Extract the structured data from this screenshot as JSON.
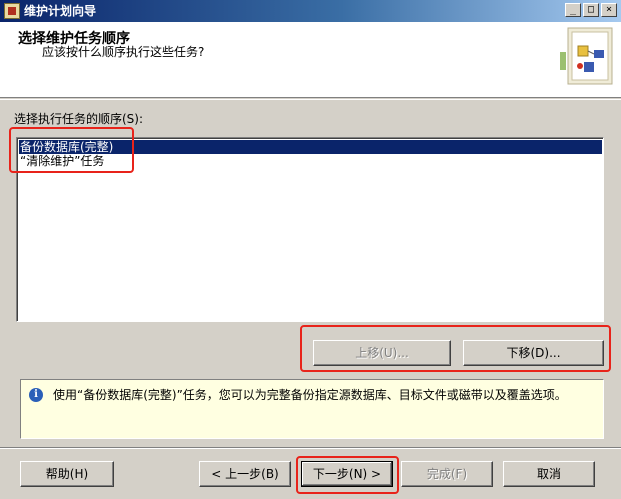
{
  "window": {
    "title": "维护计划向导",
    "minimize_glyph": "_",
    "maximize_glyph": "□",
    "close_glyph": "×"
  },
  "header": {
    "title": "选择维护任务顺序",
    "subtitle": "应该按什么顺序执行这些任务?"
  },
  "order_section": {
    "label": "选择执行任务的顺序(S):",
    "tasks": [
      {
        "label": "备份数据库(完整)",
        "selected": true
      },
      {
        "label": "“清除维护”任务",
        "selected": false
      }
    ]
  },
  "reorder_buttons": {
    "move_up": "上移(U)...",
    "move_down": "下移(D)..."
  },
  "info": {
    "icon": "info-icon",
    "text": "使用“备份数据库(完整)”任务，您可以为完整备份指定源数据库、目标文件或磁带以及覆盖选项。"
  },
  "footer": {
    "help": "帮助(H)",
    "back": "< 上一步(B)",
    "next": "下一步(N) >",
    "finish": "完成(F)",
    "cancel": "取消"
  },
  "colors": {
    "selection": "#0a246a",
    "highlight_annotation": "#e8231a",
    "info_background": "#ffffe1"
  }
}
